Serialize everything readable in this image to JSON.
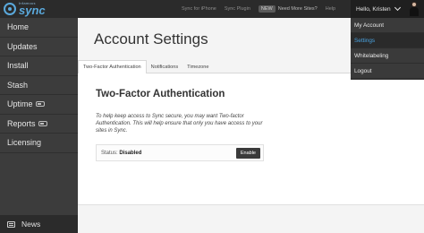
{
  "logo": {
    "small": "Infamous",
    "big": "sync"
  },
  "toplinks": {
    "iphone": "Sync for iPhone",
    "plugin": "Sync Plugin",
    "pill": "NEW",
    "need_more": "Need More Sites?",
    "help": "Help"
  },
  "user": {
    "greeting": "Hello, Kristen"
  },
  "dropdown": {
    "items": [
      {
        "label": "My Account"
      },
      {
        "label": "Settings"
      },
      {
        "label": "Whitelabeling"
      },
      {
        "label": "Logout"
      }
    ]
  },
  "sidebar": {
    "items": [
      {
        "label": "Home"
      },
      {
        "label": "Updates"
      },
      {
        "label": "Install"
      },
      {
        "label": "Stash"
      },
      {
        "label": "Uptime"
      },
      {
        "label": "Reports"
      },
      {
        "label": "Licensing"
      }
    ],
    "news": "News"
  },
  "main": {
    "title": "Account Settings",
    "tabs": [
      {
        "label": "Two-Factor Authentication"
      },
      {
        "label": "Notifications"
      },
      {
        "label": "Timezone"
      }
    ],
    "section_title": "Two-Factor Authentication",
    "description": "To help keep access to Sync secure, you may want Two-factor Authentication. This will help ensure that only you have access to your sites in Sync.",
    "status_label": "Status:",
    "status_value": "Disabled",
    "enable_button": "Enable"
  },
  "colors": {
    "accent": "#4aa3e0",
    "sidebar": "#3c3c3c",
    "topbar": "#2b2b2b"
  }
}
